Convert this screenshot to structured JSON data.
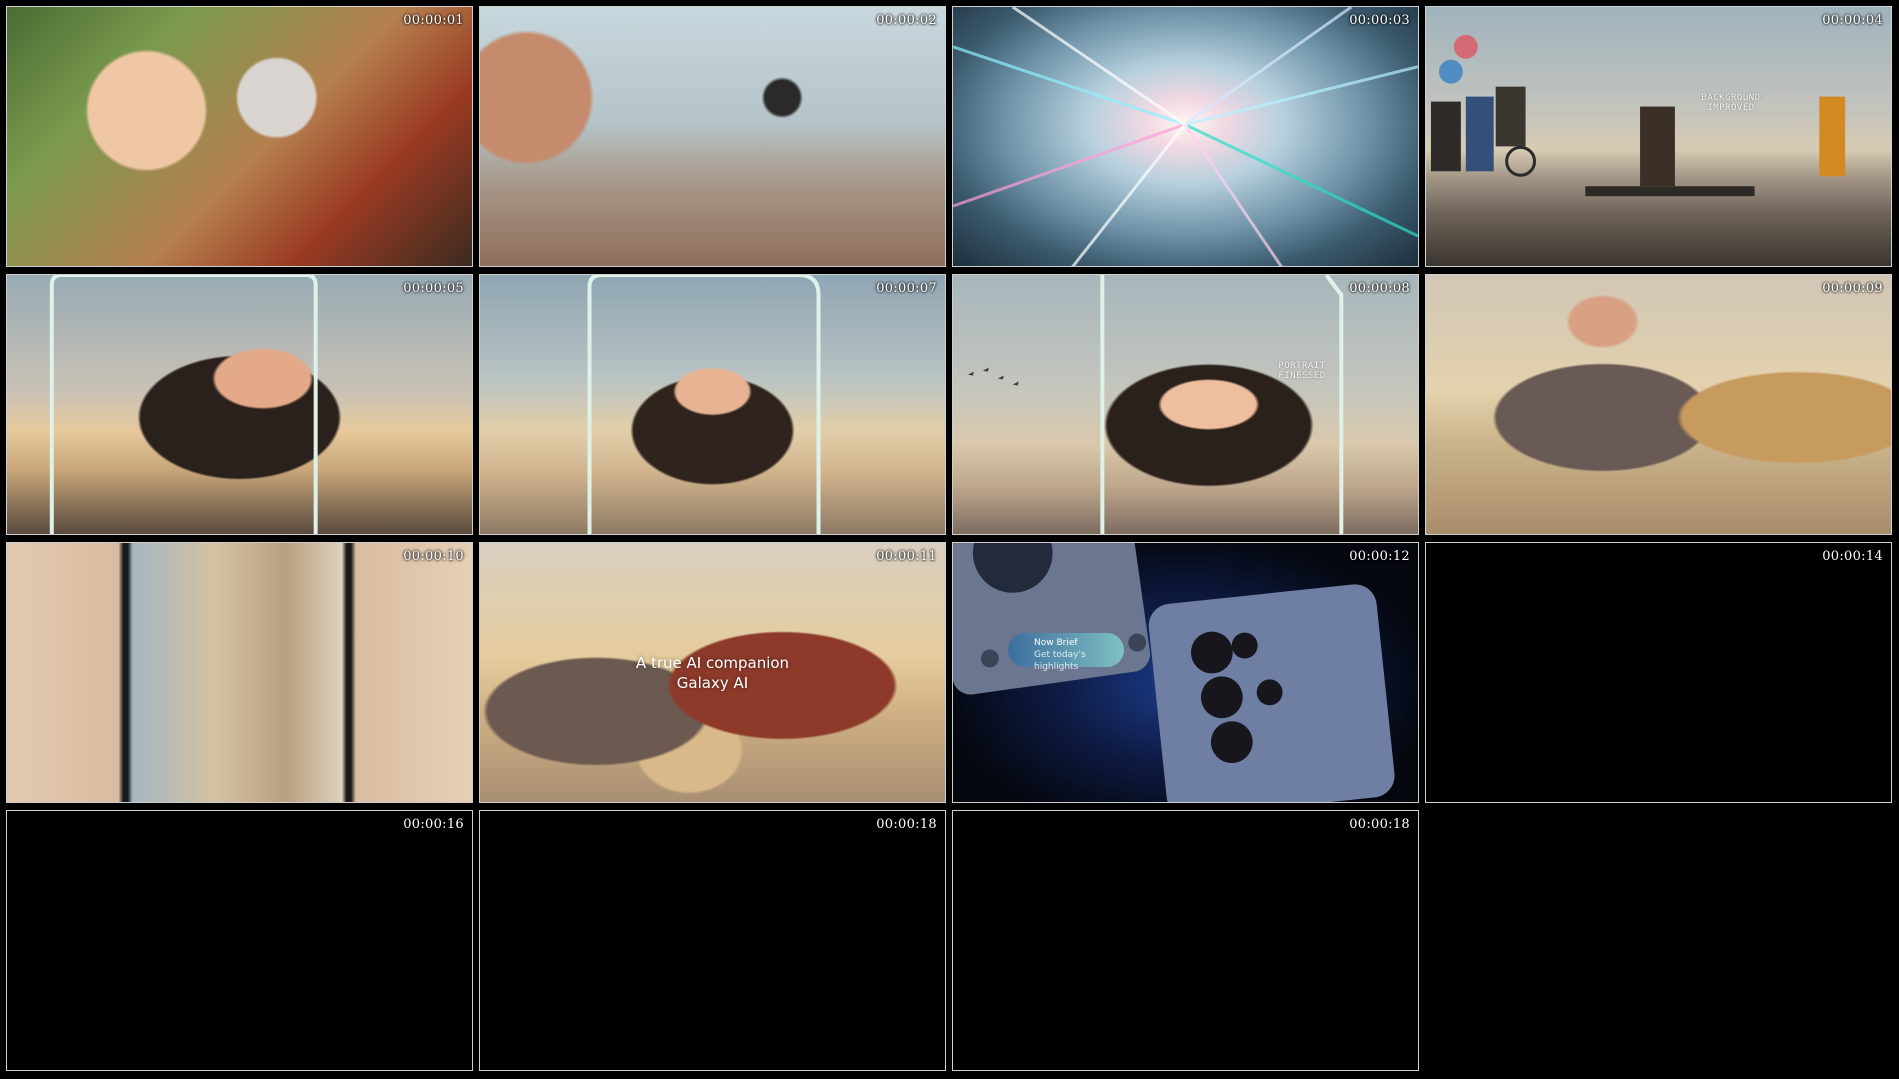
{
  "frames": [
    {
      "timestamp": "00:00:01"
    },
    {
      "timestamp": "00:00:02"
    },
    {
      "timestamp": "00:00:03"
    },
    {
      "timestamp": "00:00:04",
      "overlay": "BACKGROUND\nIMPROVED"
    },
    {
      "timestamp": "00:00:05"
    },
    {
      "timestamp": "00:00:07"
    },
    {
      "timestamp": "00:00:08",
      "overlay": "PORTRAIT\nFINESSED"
    },
    {
      "timestamp": "00:00:09"
    },
    {
      "timestamp": "00:00:10"
    },
    {
      "timestamp": "00:00:11",
      "caption_line1": "A true AI companion",
      "caption_line2": "Galaxy AI"
    },
    {
      "timestamp": "00:00:12",
      "pill_title": "Now Brief",
      "pill_sub": "Get today's highlights"
    },
    {
      "timestamp": "00:00:14"
    },
    {
      "timestamp": "00:00:16"
    },
    {
      "timestamp": "00:00:18"
    },
    {
      "timestamp": "00:00:18"
    }
  ]
}
